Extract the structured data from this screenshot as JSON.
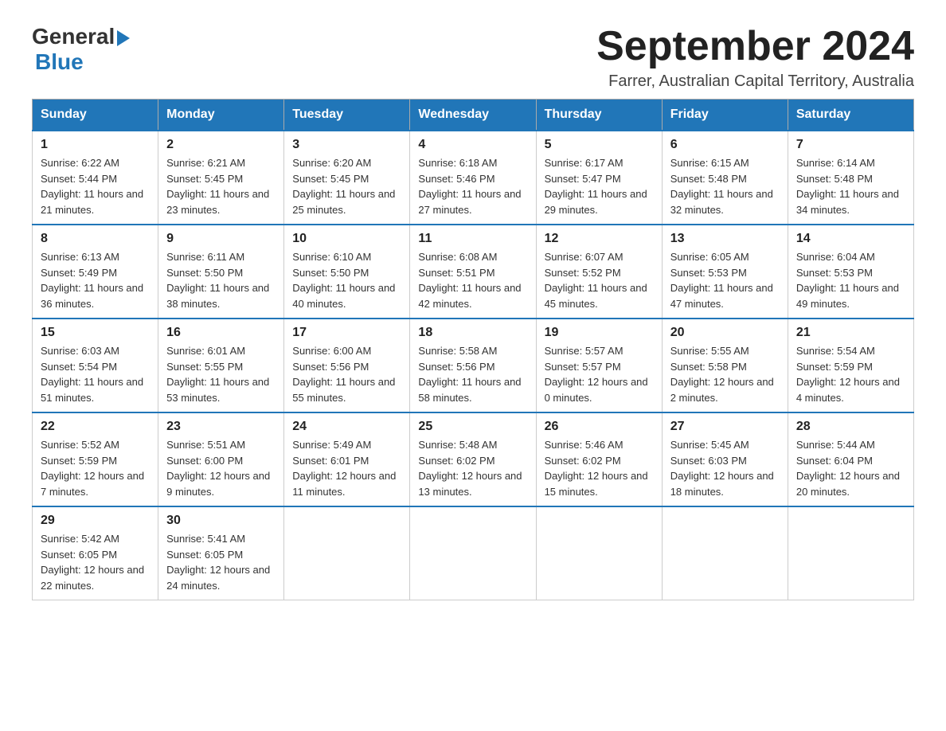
{
  "header": {
    "logo_general": "General",
    "logo_blue": "Blue",
    "month_title": "September 2024",
    "location": "Farrer, Australian Capital Territory, Australia"
  },
  "days_of_week": [
    "Sunday",
    "Monday",
    "Tuesday",
    "Wednesday",
    "Thursday",
    "Friday",
    "Saturday"
  ],
  "weeks": [
    [
      {
        "day": "1",
        "sunrise": "6:22 AM",
        "sunset": "5:44 PM",
        "daylight": "11 hours and 21 minutes."
      },
      {
        "day": "2",
        "sunrise": "6:21 AM",
        "sunset": "5:45 PM",
        "daylight": "11 hours and 23 minutes."
      },
      {
        "day": "3",
        "sunrise": "6:20 AM",
        "sunset": "5:45 PM",
        "daylight": "11 hours and 25 minutes."
      },
      {
        "day": "4",
        "sunrise": "6:18 AM",
        "sunset": "5:46 PM",
        "daylight": "11 hours and 27 minutes."
      },
      {
        "day": "5",
        "sunrise": "6:17 AM",
        "sunset": "5:47 PM",
        "daylight": "11 hours and 29 minutes."
      },
      {
        "day": "6",
        "sunrise": "6:15 AM",
        "sunset": "5:48 PM",
        "daylight": "11 hours and 32 minutes."
      },
      {
        "day": "7",
        "sunrise": "6:14 AM",
        "sunset": "5:48 PM",
        "daylight": "11 hours and 34 minutes."
      }
    ],
    [
      {
        "day": "8",
        "sunrise": "6:13 AM",
        "sunset": "5:49 PM",
        "daylight": "11 hours and 36 minutes."
      },
      {
        "day": "9",
        "sunrise": "6:11 AM",
        "sunset": "5:50 PM",
        "daylight": "11 hours and 38 minutes."
      },
      {
        "day": "10",
        "sunrise": "6:10 AM",
        "sunset": "5:50 PM",
        "daylight": "11 hours and 40 minutes."
      },
      {
        "day": "11",
        "sunrise": "6:08 AM",
        "sunset": "5:51 PM",
        "daylight": "11 hours and 42 minutes."
      },
      {
        "day": "12",
        "sunrise": "6:07 AM",
        "sunset": "5:52 PM",
        "daylight": "11 hours and 45 minutes."
      },
      {
        "day": "13",
        "sunrise": "6:05 AM",
        "sunset": "5:53 PM",
        "daylight": "11 hours and 47 minutes."
      },
      {
        "day": "14",
        "sunrise": "6:04 AM",
        "sunset": "5:53 PM",
        "daylight": "11 hours and 49 minutes."
      }
    ],
    [
      {
        "day": "15",
        "sunrise": "6:03 AM",
        "sunset": "5:54 PM",
        "daylight": "11 hours and 51 minutes."
      },
      {
        "day": "16",
        "sunrise": "6:01 AM",
        "sunset": "5:55 PM",
        "daylight": "11 hours and 53 minutes."
      },
      {
        "day": "17",
        "sunrise": "6:00 AM",
        "sunset": "5:56 PM",
        "daylight": "11 hours and 55 minutes."
      },
      {
        "day": "18",
        "sunrise": "5:58 AM",
        "sunset": "5:56 PM",
        "daylight": "11 hours and 58 minutes."
      },
      {
        "day": "19",
        "sunrise": "5:57 AM",
        "sunset": "5:57 PM",
        "daylight": "12 hours and 0 minutes."
      },
      {
        "day": "20",
        "sunrise": "5:55 AM",
        "sunset": "5:58 PM",
        "daylight": "12 hours and 2 minutes."
      },
      {
        "day": "21",
        "sunrise": "5:54 AM",
        "sunset": "5:59 PM",
        "daylight": "12 hours and 4 minutes."
      }
    ],
    [
      {
        "day": "22",
        "sunrise": "5:52 AM",
        "sunset": "5:59 PM",
        "daylight": "12 hours and 7 minutes."
      },
      {
        "day": "23",
        "sunrise": "5:51 AM",
        "sunset": "6:00 PM",
        "daylight": "12 hours and 9 minutes."
      },
      {
        "day": "24",
        "sunrise": "5:49 AM",
        "sunset": "6:01 PM",
        "daylight": "12 hours and 11 minutes."
      },
      {
        "day": "25",
        "sunrise": "5:48 AM",
        "sunset": "6:02 PM",
        "daylight": "12 hours and 13 minutes."
      },
      {
        "day": "26",
        "sunrise": "5:46 AM",
        "sunset": "6:02 PM",
        "daylight": "12 hours and 15 minutes."
      },
      {
        "day": "27",
        "sunrise": "5:45 AM",
        "sunset": "6:03 PM",
        "daylight": "12 hours and 18 minutes."
      },
      {
        "day": "28",
        "sunrise": "5:44 AM",
        "sunset": "6:04 PM",
        "daylight": "12 hours and 20 minutes."
      }
    ],
    [
      {
        "day": "29",
        "sunrise": "5:42 AM",
        "sunset": "6:05 PM",
        "daylight": "12 hours and 22 minutes."
      },
      {
        "day": "30",
        "sunrise": "5:41 AM",
        "sunset": "6:05 PM",
        "daylight": "12 hours and 24 minutes."
      },
      null,
      null,
      null,
      null,
      null
    ]
  ]
}
